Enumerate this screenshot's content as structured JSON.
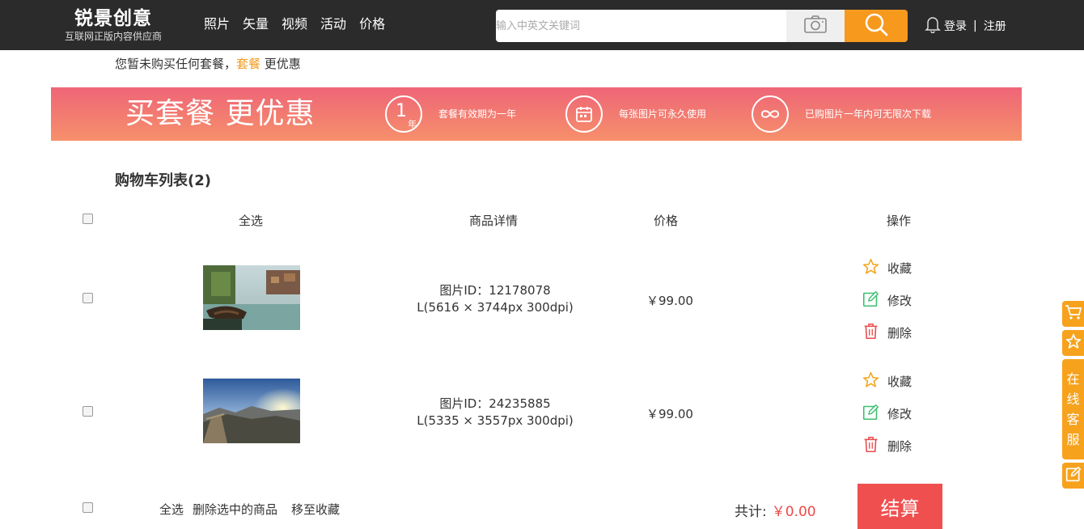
{
  "header": {
    "logo_title": "锐景创意",
    "logo_subtitle": "互联网正版内容供应商",
    "nav": [
      "照片",
      "矢量",
      "视频",
      "活动",
      "价格"
    ],
    "search_placeholder": "输入中英文关键词",
    "login": "登录",
    "separator": "|",
    "register": "注册"
  },
  "notice": {
    "prefix": "您暂未购买任何套餐，",
    "link": "套餐",
    "suffix": " 更优惠"
  },
  "banner": {
    "title": "买套餐 更优惠",
    "features": [
      {
        "icon": "one-year-icon",
        "badge_num": "1",
        "badge_unit": "年",
        "text": "套餐有效期为一年"
      },
      {
        "icon": "calendar-icon",
        "text": "每张图片可永久使用"
      },
      {
        "icon": "infinity-icon",
        "text": "已购图片一年内可无限次下载"
      }
    ]
  },
  "cart": {
    "title": "购物车列表(2)",
    "columns": {
      "select_all": "全选",
      "detail": "商品详情",
      "price": "价格",
      "ops": "操作"
    },
    "items": [
      {
        "id_line": "图片ID：12178078",
        "spec_line": "L(5616 × 3744px 300dpi)",
        "price": "￥99.00",
        "ops": {
          "favorite": "收藏",
          "edit": "修改",
          "delete": "删除"
        }
      },
      {
        "id_line": "图片ID：24235885",
        "spec_line": "L(5335 × 3557px 300dpi)",
        "price": "￥99.00",
        "ops": {
          "favorite": "收藏",
          "edit": "修改",
          "delete": "删除"
        }
      }
    ],
    "footer": {
      "select_all": "全选",
      "delete_selected": "删除选中的商品",
      "move_to_fav": "移至收藏",
      "total_label": "共计:",
      "total_amount": "￥0.00",
      "checkout": "结算"
    }
  },
  "sidebar": {
    "cart_icon": "cart-icon",
    "star_icon": "star-icon",
    "service_chars": [
      "在",
      "线",
      "客",
      "服"
    ],
    "edit_icon": "edit-icon"
  },
  "colors": {
    "header_bg": "#2b2b2b",
    "accent_orange": "#f7991d",
    "banner_top": "#ee6577",
    "banner_bottom": "#f6906b",
    "checkout_red": "#f04f4f",
    "fav_icon": "#f2a51d",
    "edit_icon": "#3bbf6f",
    "delete_icon": "#e84c4c"
  }
}
